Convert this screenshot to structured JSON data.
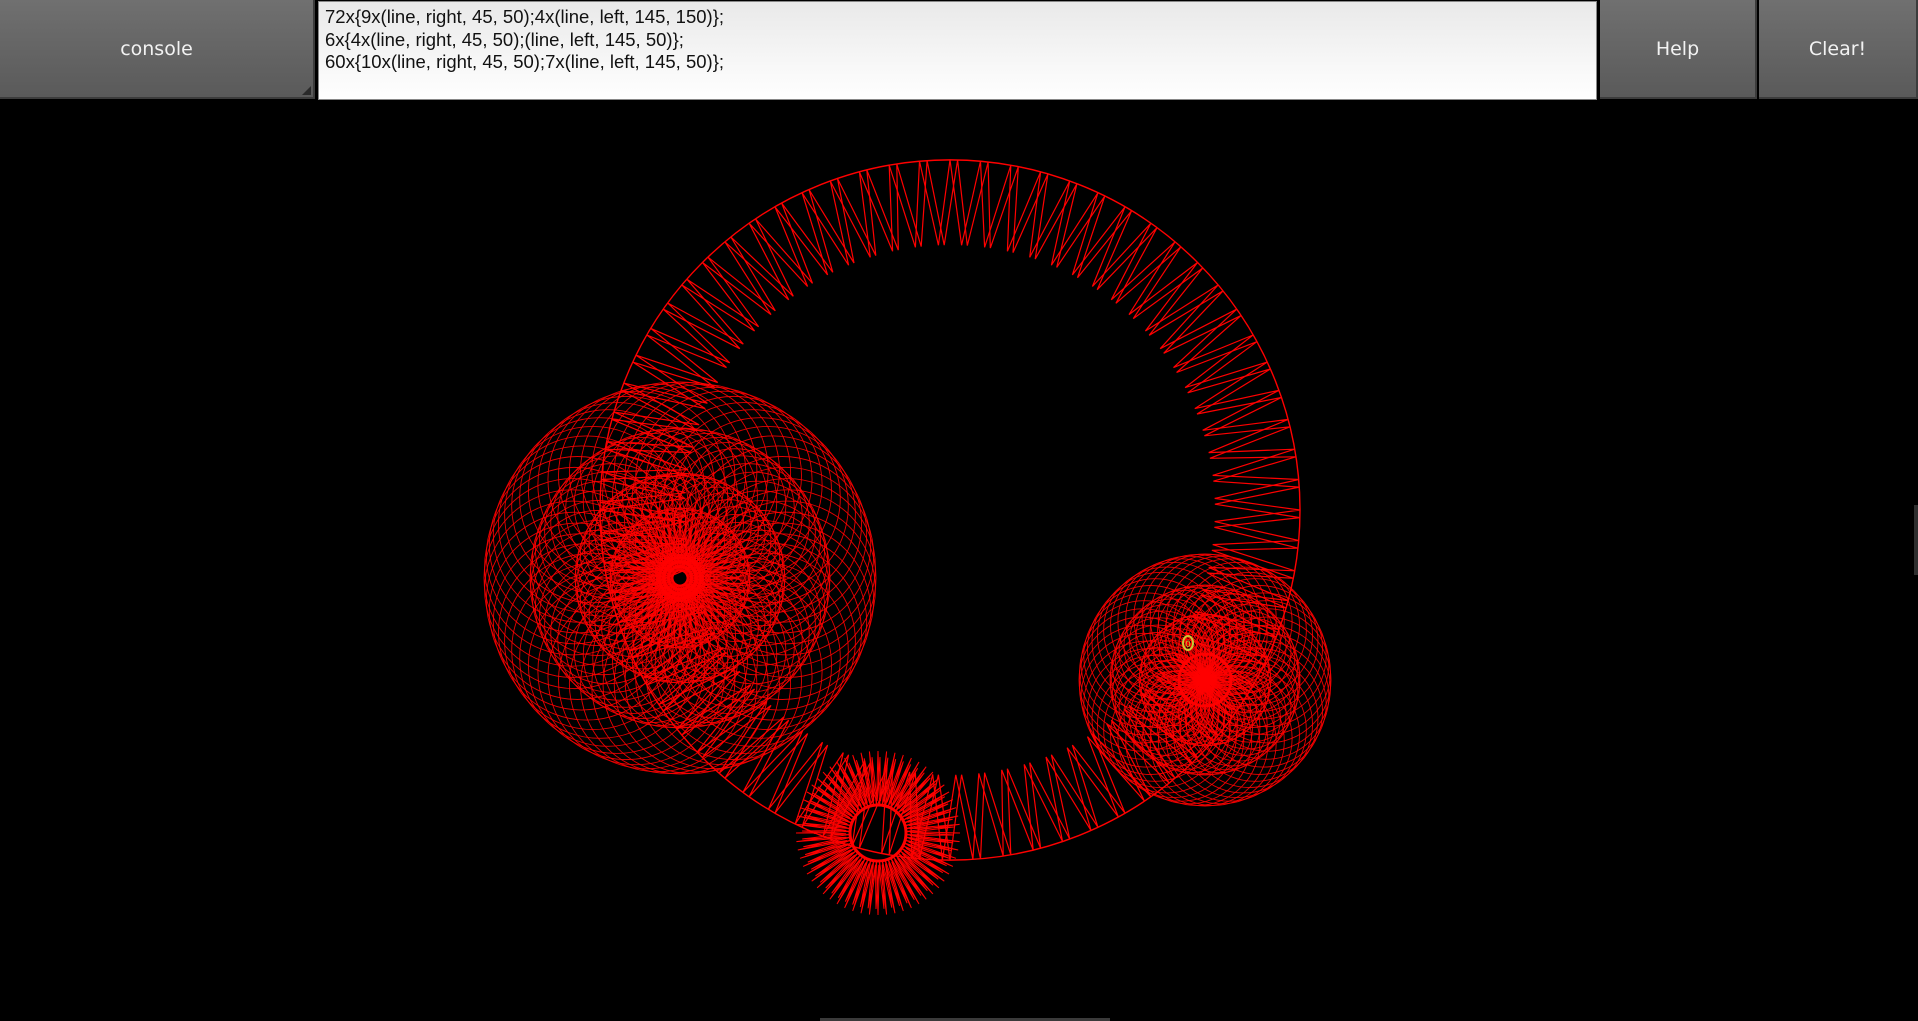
{
  "toolbar": {
    "console_label": "console",
    "help_label": "Help",
    "clear_label": "Clear!"
  },
  "console": {
    "lines": [
      "72x{9x(line, right, 45, 50);4x(line, left, 145, 150)};",
      "6x{4x(line, right, 45, 50);(line, left, 145, 50)};",
      "60x{10x(line, right, 45, 50);7x(line, left, 145, 50)};"
    ]
  },
  "canvas": {
    "background": "#000000",
    "stroke_color": "#ff0000",
    "turtle": {
      "label": "0",
      "color": "#c8c832"
    }
  }
}
